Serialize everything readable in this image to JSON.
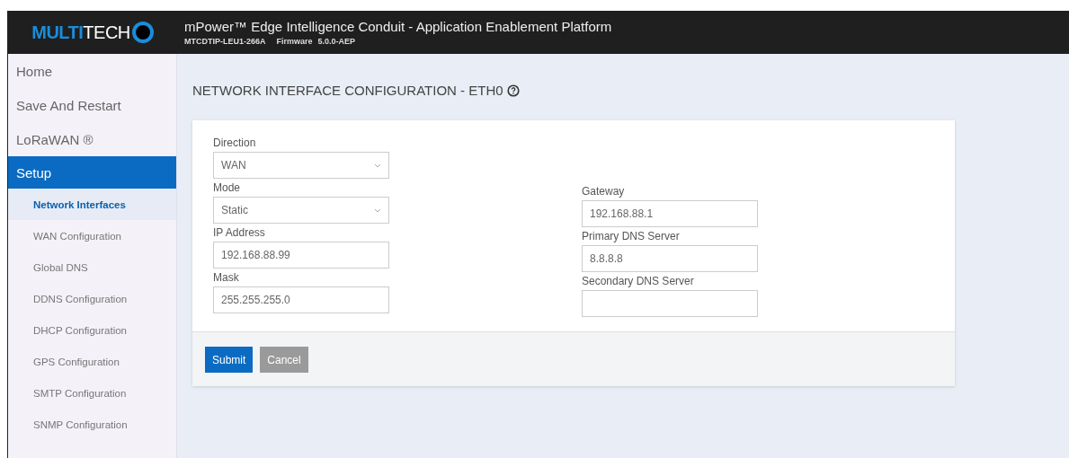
{
  "header": {
    "logo": {
      "part_1": "MULTI",
      "part_2": "TECH"
    },
    "title": "mPower™ Edge Intelligence Conduit - Application Enablement Platform",
    "model": "MTCDTIP-LEU1-266A",
    "firmware_label": "Firmware",
    "firmware": "5.0.0-AEP"
  },
  "sidebar": {
    "items": [
      {
        "label": "Home",
        "kind": "top",
        "selected": false
      },
      {
        "label": "Save And Restart",
        "kind": "top",
        "selected": false
      },
      {
        "label": "LoRaWAN ®",
        "kind": "top",
        "selected": false
      },
      {
        "label": "Setup",
        "kind": "top",
        "selected": true
      },
      {
        "label": "Network Interfaces",
        "kind": "sub",
        "selected": true
      },
      {
        "label": "WAN Configuration",
        "kind": "sub",
        "selected": false
      },
      {
        "label": "Global DNS",
        "kind": "sub",
        "selected": false
      },
      {
        "label": "DDNS Configuration",
        "kind": "sub",
        "selected": false
      },
      {
        "label": "DHCP Configuration",
        "kind": "sub",
        "selected": false
      },
      {
        "label": "GPS Configuration",
        "kind": "sub",
        "selected": false
      },
      {
        "label": "SMTP Configuration",
        "kind": "sub",
        "selected": false
      },
      {
        "label": "SNMP Configuration",
        "kind": "sub",
        "selected": false
      }
    ]
  },
  "page": {
    "title": "NETWORK INTERFACE CONFIGURATION - ETH0",
    "left_fields": [
      {
        "label": "Direction",
        "kind": "select",
        "value": "WAN"
      },
      {
        "label": "Mode",
        "kind": "select",
        "value": "Static"
      },
      {
        "label": "IP Address",
        "kind": "text",
        "value": "192.168.88.99"
      },
      {
        "label": "Mask",
        "kind": "text",
        "value": "255.255.255.0"
      }
    ],
    "right_fields": [
      {
        "label": "Gateway",
        "kind": "text",
        "value": "192.168.88.1"
      },
      {
        "label": "Primary DNS Server",
        "kind": "text",
        "value": "8.8.8.8"
      },
      {
        "label": "Secondary DNS Server",
        "kind": "text"
      }
    ],
    "buttons": [
      {
        "label": "Submit",
        "kind": "primary"
      },
      {
        "label": "Cancel",
        "kind": "secondary"
      }
    ]
  }
}
